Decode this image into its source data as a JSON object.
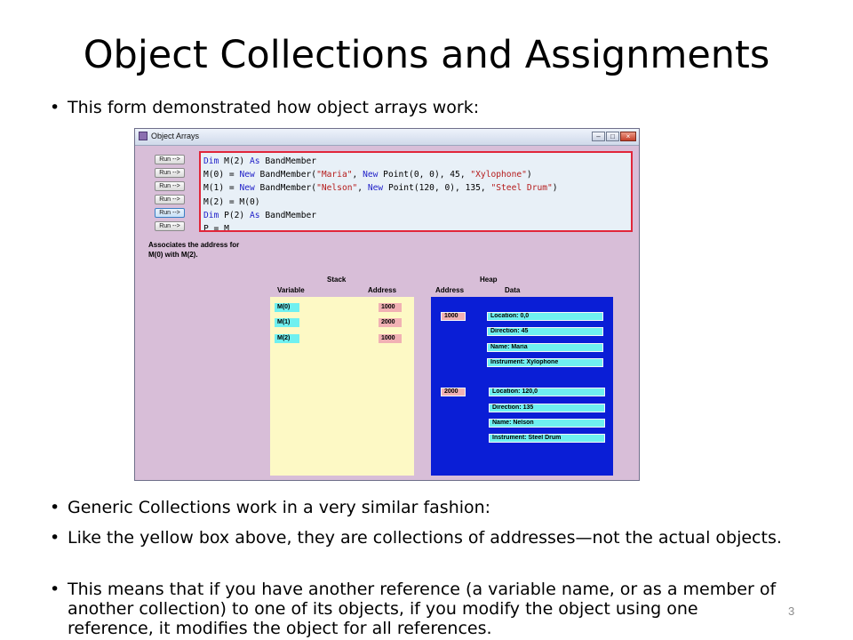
{
  "slide": {
    "title": "Object Collections and Assignments",
    "bullets": [
      "This form demonstrated how object arrays work:",
      "Generic Collections work in a very similar fashion:",
      "Like the yellow box above, they are collections of addresses—not the actual objects.",
      "This means that if you have another reference (a variable name, or as a member of another collection) to one of its objects, if you modify the object using one reference, it modifies the object for all references."
    ],
    "bullet_glyph": "•",
    "page_number": "3"
  },
  "window": {
    "title": "Object Arrays",
    "controls": {
      "minimize": "–",
      "maximize": "□",
      "close": "×"
    },
    "run_buttons": [
      "Run -->",
      "Run -->",
      "Run -->",
      "Run -->",
      "Run -->",
      "Run -->",
      "Run -->"
    ],
    "active_run_index": 4,
    "code_lines": [
      "Dim M(2) As BandMember",
      "M(0) = New BandMember(\"Maria\", New Point(0, 0), 45, \"Xylophone\")",
      "M(1) = New BandMember(\"Nelson\", New Point(120, 0), 135, \"Steel Drum\")",
      "M(2) = M(0)",
      "Dim P(2) As BandMember",
      "P = M"
    ],
    "status_line1": "Associates the address for",
    "status_line2_bold": "M(0)",
    "status_line2_mid": " with ",
    "status_line2_bold2": "M(2)",
    "status_line2_end": ".",
    "stack": {
      "title": "Stack",
      "col_variable": "Variable",
      "col_address": "Address",
      "rows": [
        {
          "variable": "M(0)",
          "address": "1000"
        },
        {
          "variable": "M(1)",
          "address": "2000"
        },
        {
          "variable": "M(2)",
          "address": "1000"
        }
      ]
    },
    "heap": {
      "title": "Heap",
      "col_address": "Address",
      "col_data": "Data",
      "objects": [
        {
          "address": "1000",
          "fields": [
            "Location: 0,0",
            "Direction: 45",
            "Name: Maria",
            "Instrument: Xylophone"
          ]
        },
        {
          "address": "2000",
          "fields": [
            "Location: 120,0",
            "Direction: 135",
            "Name: Nelson",
            "Instrument: Steel Drum"
          ]
        }
      ]
    },
    "colors": {
      "form_bg": "#d8bed8",
      "code_border": "#e1263a",
      "stack_bg": "#fdf9c5",
      "heap_bg": "#0a1ed6",
      "variable_cell": "#6ff0f0",
      "address_cell": "#f1b1b4",
      "keyword": "#1f1fc8",
      "string": "#b51b1b"
    }
  }
}
